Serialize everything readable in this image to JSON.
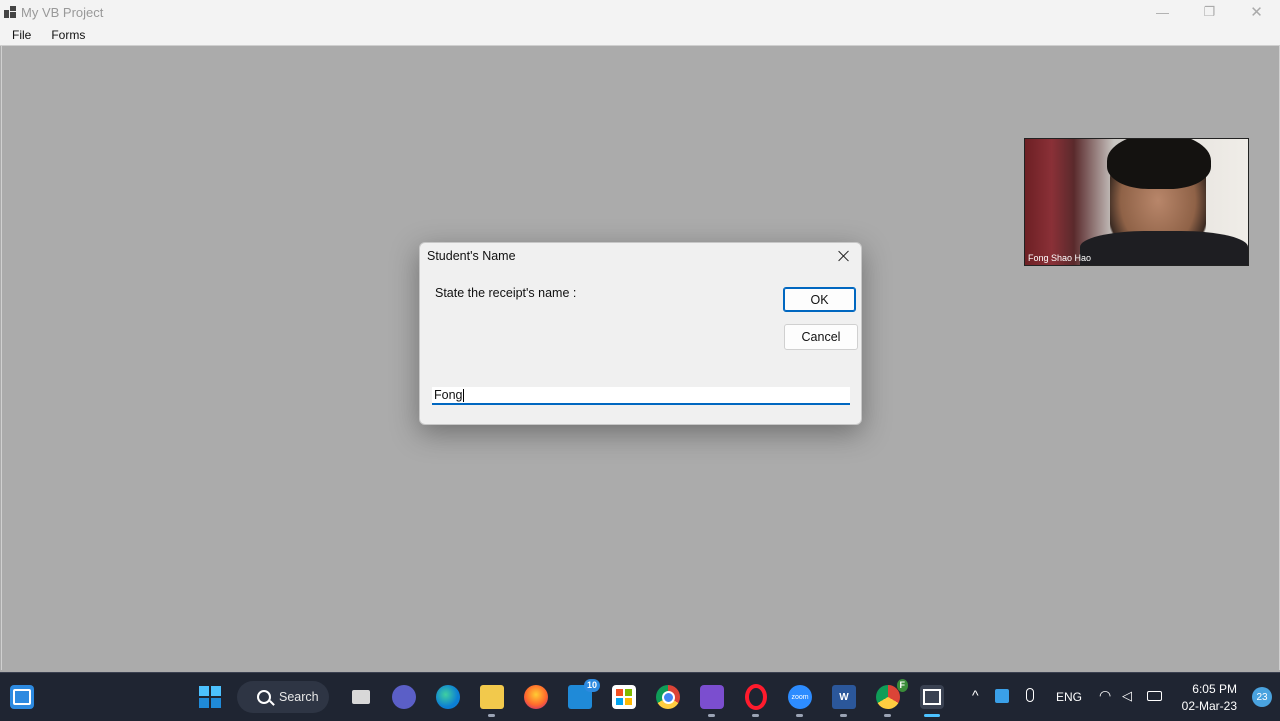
{
  "window": {
    "title": "My VB Project",
    "minimize_glyph": "—",
    "restore_glyph": "❐",
    "close_glyph": "✕"
  },
  "menu": {
    "items": [
      "File",
      "Forms"
    ]
  },
  "video": {
    "participant_name": "Fong Shao Hao"
  },
  "dialog": {
    "title": "Student's Name",
    "prompt": "State the receipt's name :",
    "ok_label": "OK",
    "cancel_label": "Cancel",
    "input_value": "Fong"
  },
  "taskbar": {
    "search_label": "Search",
    "mail_badge": "10",
    "chrome_profile_badge": "F",
    "zoom_label": "zoom",
    "word_label": "W",
    "language": "ENG",
    "time": "6:05 PM",
    "date": "02-Mar-23",
    "notification_count": "23"
  },
  "colors": {
    "accent": "#0067c0",
    "taskbar_bg": "#1f2532",
    "mdi_bg": "#ababab"
  }
}
